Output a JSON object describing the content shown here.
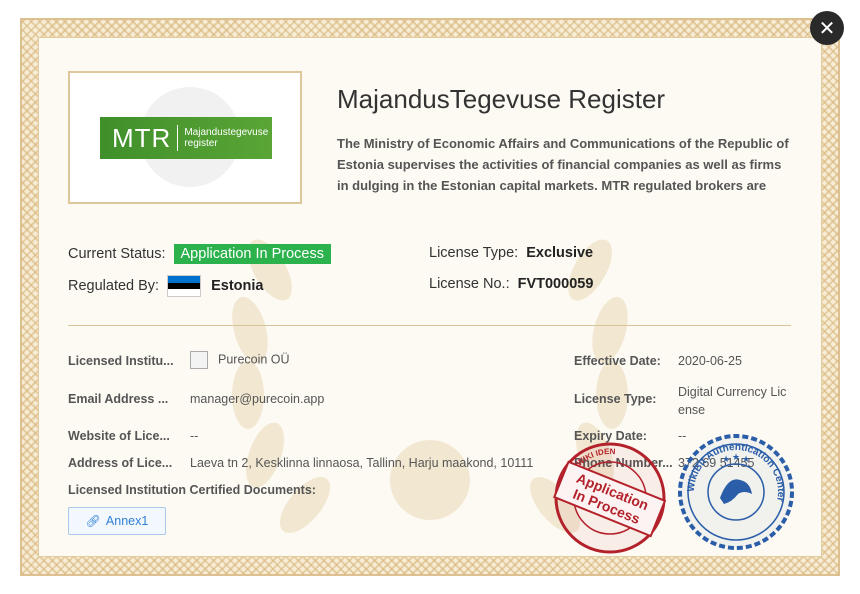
{
  "register": {
    "logo_abbr": "MTR",
    "logo_name_line1": "Majandustegevuse",
    "logo_name_line2": "register",
    "title": "MajandusTegevuse Register",
    "description": "The Ministry of Economic Affairs and Communications of the Republic of Estonia supervises the activities of financial companies as well as firms in dulging in the Estonian capital markets. MTR regulated brokers are reg..."
  },
  "summary": {
    "status_label": "Current Status:",
    "status_value": "Application In Process",
    "regulated_label": "Regulated By:",
    "regulated_value": "Estonia",
    "license_type_label": "License Type:",
    "license_type_value": "Exclusive",
    "license_no_label": "License No.:",
    "license_no_value": "FVT000059"
  },
  "details": {
    "institution_label": "Licensed Institu...",
    "institution_value": "Purecoin OÜ",
    "email_label": "Email Address ...",
    "email_value": "manager@purecoin.app",
    "website_label": "Website of Lice...",
    "website_value": "--",
    "address_label": "Address of Lice...",
    "address_value": "Laeva tn 2, Kesklinna linnaosa, Tallinn, Harju maakond, 10111",
    "documents_label": "Licensed Institution Certified Documents:",
    "effective_label": "Effective Date:",
    "effective_value": "2020-06-25",
    "license_type_label": "License Type:",
    "license_type_line1": "Digital Currency Lic",
    "license_type_line2": "ense",
    "expiry_label": "Expiry Date:",
    "expiry_value": "--",
    "phone_label": "Phone Number...",
    "phone_value": "372 69 51455"
  },
  "annex": {
    "label": "Annex1",
    "icon": "link-icon"
  },
  "close": {
    "icon": "close-icon",
    "glyph": "✕"
  },
  "stamps": {
    "red_line1": "Application",
    "red_line2": "In Process",
    "red_ring": "CENTER WIKI IDEN",
    "blue_ring": "WikiBit Authentication Center"
  },
  "colors": {
    "status_green": "#2bb24c",
    "stamp_red": "#b3222b",
    "stamp_blue": "#2b5ea8",
    "link_blue": "#2e7fd6"
  }
}
